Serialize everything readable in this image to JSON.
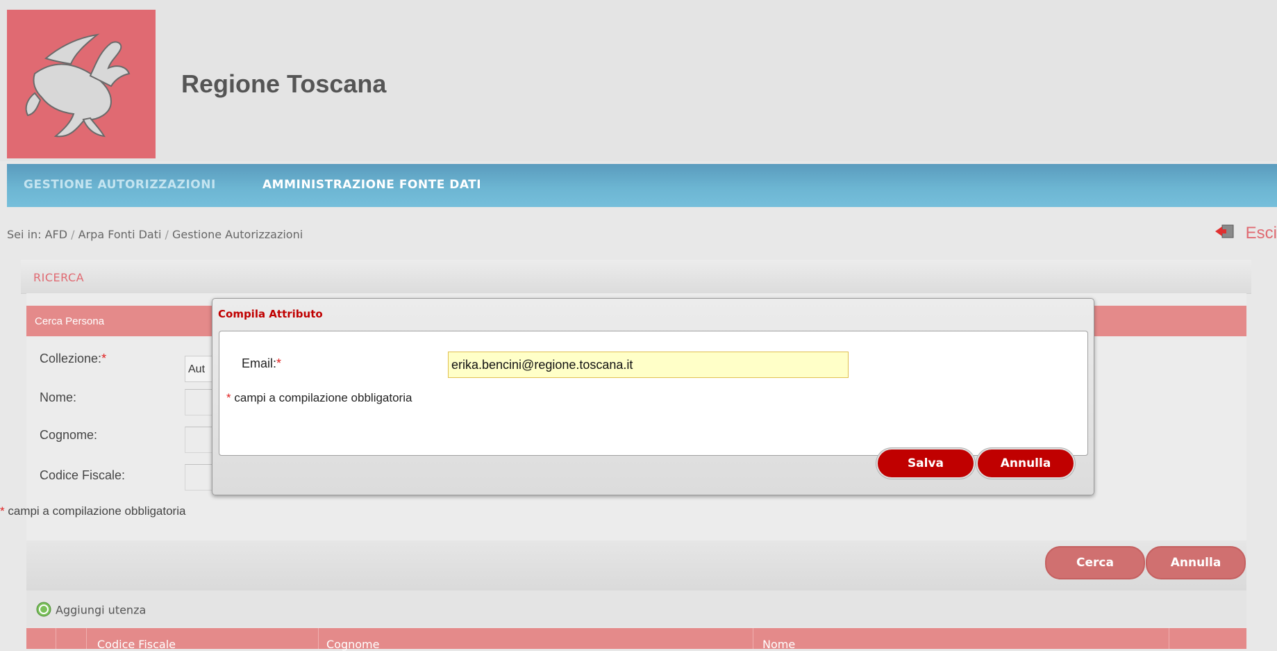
{
  "header": {
    "site_title": "Regione Toscana"
  },
  "nav": {
    "items": [
      {
        "label": "GESTIONE AUTORIZZAZIONI"
      },
      {
        "label": "AMMINISTRAZIONE FONTE DATI"
      }
    ]
  },
  "breadcrumb": {
    "prefix": "Sei in:",
    "items": [
      "AFD",
      "Arpa Fonti Dati",
      "Gestione Autorizzazioni"
    ],
    "separator": "/"
  },
  "exit": {
    "label": "Esci",
    "icon": "exit-door-icon"
  },
  "panel": {
    "section_label": "RICERCA",
    "form_title": "Cerca Persona",
    "fields": {
      "collezione_label": "Collezione:",
      "collezione_value": "Aut",
      "nome_label": "Nome:",
      "cognome_label": "Cognome:",
      "codice_fiscale_label": "Codice Fiscale:"
    },
    "required_marker": "*",
    "required_note": "campi a compilazione obbligatoria",
    "buttons": {
      "search": "Cerca",
      "cancel": "Annulla"
    },
    "add_user": {
      "label": "Aggiungi utenza",
      "icon": "add-circle-icon"
    },
    "table": {
      "columns": [
        "Codice Fiscale",
        "Cognome",
        "Nome"
      ]
    }
  },
  "dialog": {
    "title": "Compila Attributo",
    "email_label": "Email:",
    "email_value": "erika.bencini@regione.toscana.it",
    "required_marker": "*",
    "required_note": "campi a compilazione obbligatoria",
    "save": "Salva",
    "cancel": "Annulla"
  },
  "colors": {
    "brand_red": "#e06a72",
    "nav_blue": "#6cb5d2",
    "dialog_button": "#c00000",
    "panel_header": "#e48a8a",
    "email_input_bg": "#ffffc8"
  }
}
